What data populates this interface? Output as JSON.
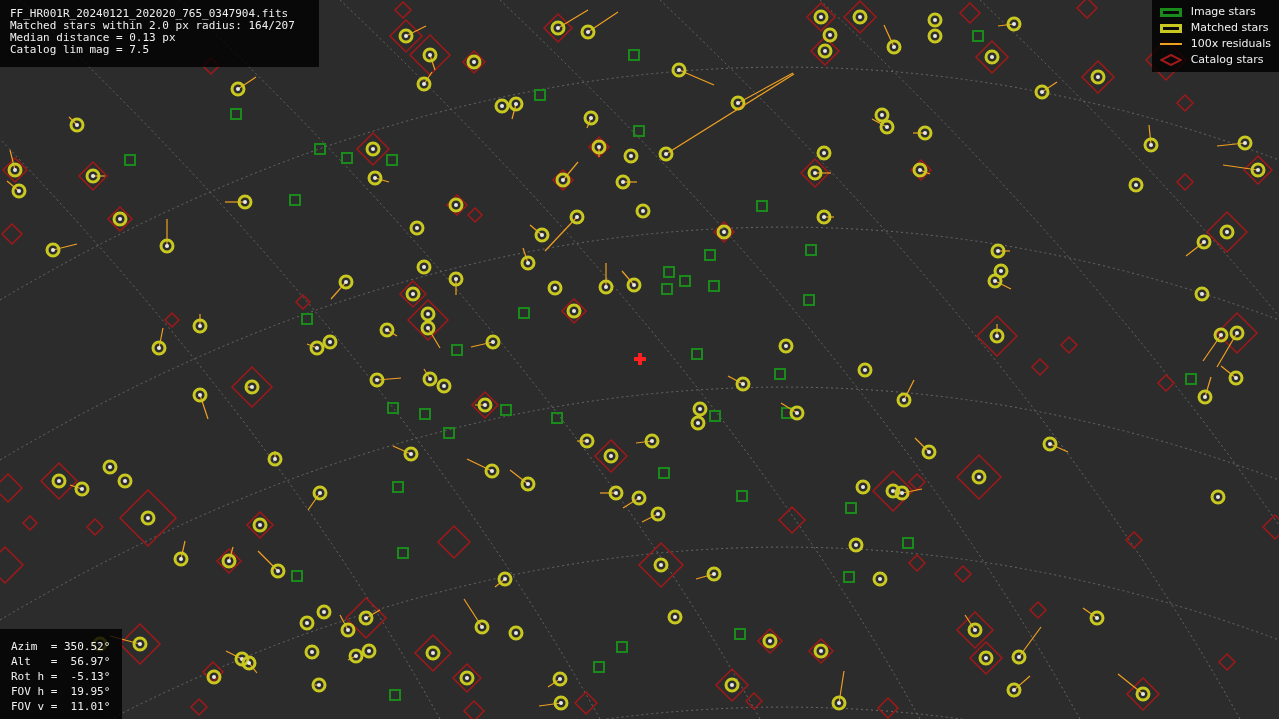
{
  "info": [
    "FF_HR001R_20240121_202020_765_0347904.fits",
    "Matched stars within 2.0 px radius: 164/207",
    "Median distance = 0.13 px",
    "Catalog lim mag = 7.5"
  ],
  "legend": [
    {
      "kind": "image",
      "label": "Image stars"
    },
    {
      "kind": "matched",
      "label": "Matched stars"
    },
    {
      "kind": "residual",
      "label": "100x residuals"
    },
    {
      "kind": "catalog",
      "label": "Catalog stars"
    }
  ],
  "pointing": [
    "Azim  = 350.52°",
    "Alt   =  56.97°",
    "Rot h =  -5.13°",
    "FOV h =  19.95°",
    "FOV v =  11.01°"
  ]
}
